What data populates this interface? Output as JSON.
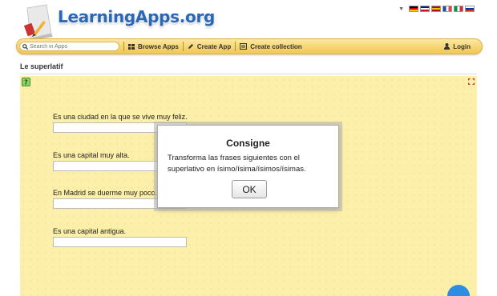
{
  "header": {
    "logo_text": "LearningApps.org",
    "languages": [
      {
        "name": "de-flag-icon",
        "colors": [
          "#000000",
          "#dd0000",
          "#ffce00"
        ]
      },
      {
        "name": "gb-flag-icon",
        "colors": [
          "#012169",
          "#ffffff",
          "#c8102e"
        ]
      },
      {
        "name": "es-flag-icon",
        "colors": [
          "#aa151b",
          "#f1bf00",
          "#aa151b"
        ]
      },
      {
        "name": "fr-flag-icon",
        "colors": [
          "#0055a4",
          "#ffffff",
          "#ef4135"
        ]
      },
      {
        "name": "it-flag-icon",
        "colors": [
          "#009246",
          "#ffffff",
          "#ce2b37"
        ]
      },
      {
        "name": "ru-flag-icon",
        "colors": [
          "#ffffff",
          "#0039a6",
          "#d52b1e"
        ]
      }
    ]
  },
  "toolbar": {
    "search_placeholder": "Search in Apps",
    "browse_label": "Browse Apps",
    "create_label": "Create App",
    "collection_label": "Create collection",
    "login_label": "Login"
  },
  "app": {
    "title": "Le superlatif",
    "questions": [
      {
        "label": "Es una ciudad en la que se vive muy feliz.",
        "value": ""
      },
      {
        "label": "Es una capital muy alta.",
        "value": ""
      },
      {
        "label": "En Madrid se duerme muy poco.",
        "value": ""
      },
      {
        "label": "Es una capital antigua.",
        "value": ""
      }
    ]
  },
  "dialog": {
    "title": "Consigne",
    "text": "Transforma las frases siguientes con el superlativo en ísimo/ísima/ísimos/ísimas.",
    "ok_label": "OK"
  },
  "colors": {
    "toolbar": "#f3c653",
    "stage": "#fcefa9",
    "logo": "#2a68b7",
    "accent_button": "#2b8ee0"
  }
}
